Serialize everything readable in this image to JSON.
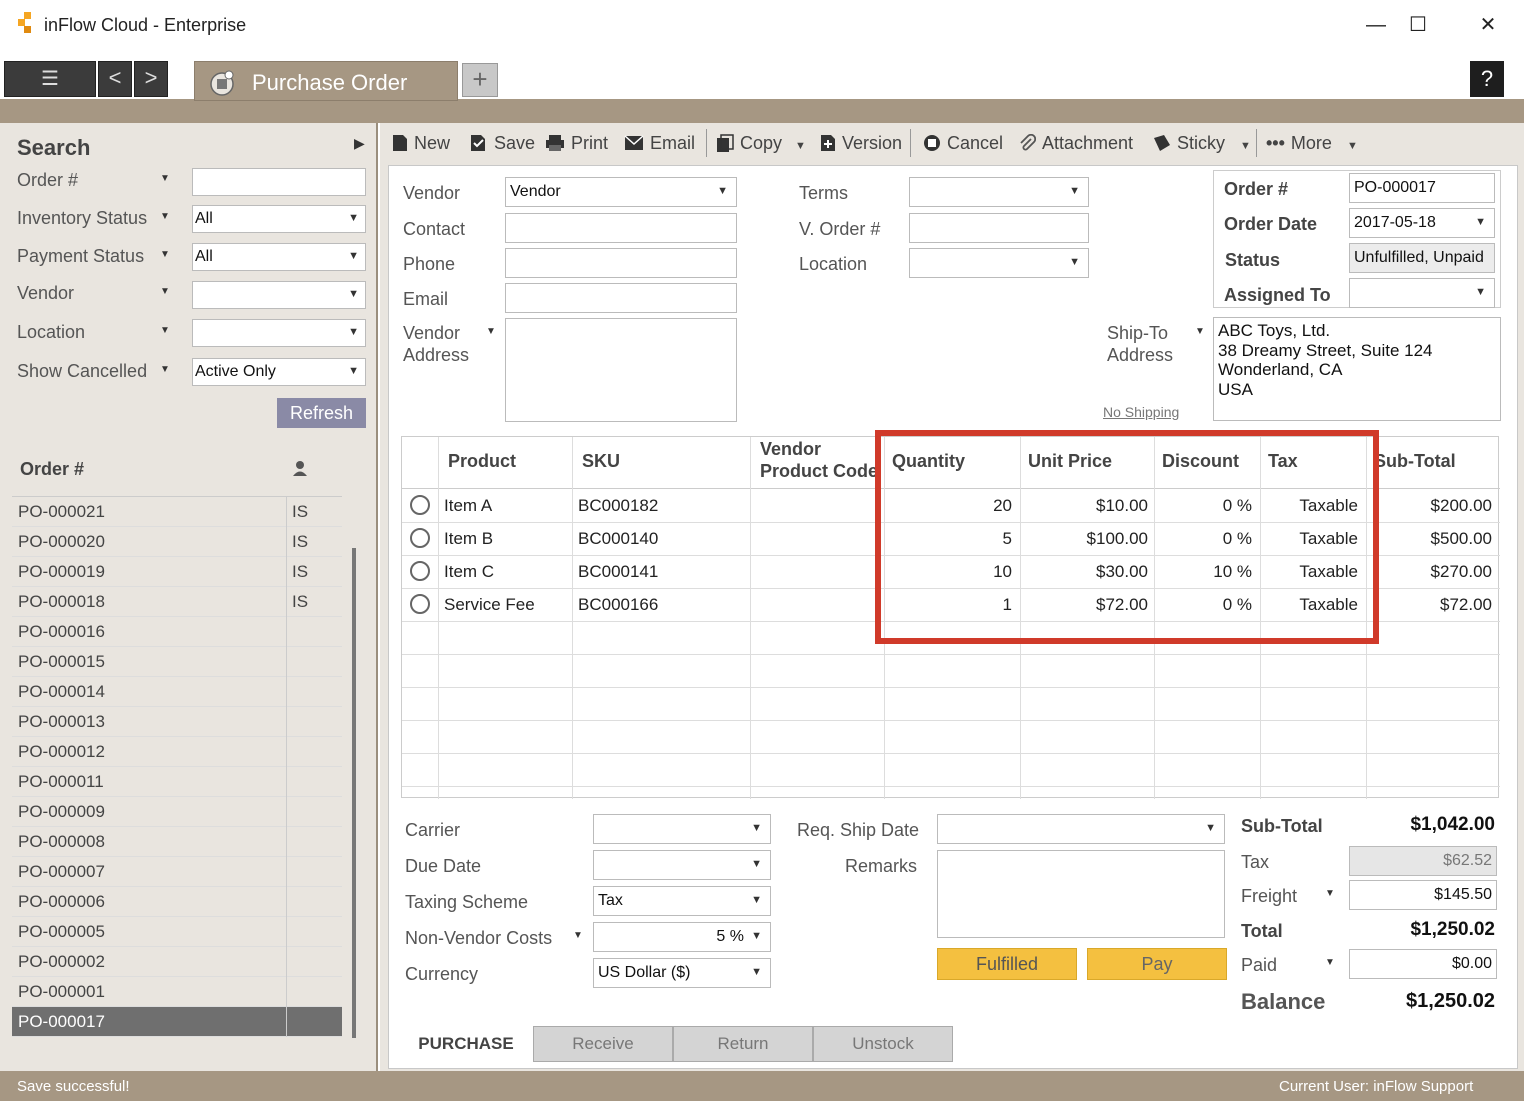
{
  "window": {
    "title": "inFlow Cloud - Enterprise",
    "minimize": "—",
    "maximize": "☐",
    "close": "✕"
  },
  "nav": {
    "menu": "☰",
    "back": "<",
    "forward": ">",
    "plus": "+",
    "help": "?"
  },
  "tab": {
    "label": "Purchase Order"
  },
  "sidebar": {
    "header": "Search",
    "filters": [
      {
        "label": "Order #",
        "value": ""
      },
      {
        "label": "Inventory Status",
        "value": "All"
      },
      {
        "label": "Payment Status",
        "value": "All"
      },
      {
        "label": "Vendor",
        "value": ""
      },
      {
        "label": "Location",
        "value": ""
      },
      {
        "label": "Show Cancelled",
        "value": "Active Only"
      }
    ],
    "refresh": "Refresh",
    "list_header": "Order #",
    "orders": [
      {
        "num": "PO-000021",
        "status": "IS"
      },
      {
        "num": "PO-000020",
        "status": "IS"
      },
      {
        "num": "PO-000019",
        "status": "IS"
      },
      {
        "num": "PO-000018",
        "status": "IS"
      },
      {
        "num": "PO-000016",
        "status": ""
      },
      {
        "num": "PO-000015",
        "status": ""
      },
      {
        "num": "PO-000014",
        "status": ""
      },
      {
        "num": "PO-000013",
        "status": ""
      },
      {
        "num": "PO-000012",
        "status": ""
      },
      {
        "num": "PO-000011",
        "status": ""
      },
      {
        "num": "PO-000009",
        "status": ""
      },
      {
        "num": "PO-000008",
        "status": ""
      },
      {
        "num": "PO-000007",
        "status": ""
      },
      {
        "num": "PO-000006",
        "status": ""
      },
      {
        "num": "PO-000005",
        "status": ""
      },
      {
        "num": "PO-000002",
        "status": ""
      },
      {
        "num": "PO-000001",
        "status": ""
      },
      {
        "num": "PO-000017",
        "status": ""
      }
    ]
  },
  "toolbar": {
    "new": "New",
    "save": "Save",
    "print": "Print",
    "email": "Email",
    "copy": "Copy",
    "version": "Version",
    "cancel": "Cancel",
    "attachment": "Attachment",
    "sticky": "Sticky",
    "more": "More"
  },
  "form": {
    "vendor_label": "Vendor",
    "vendor_value": "Vendor",
    "contact_label": "Contact",
    "phone_label": "Phone",
    "email_label": "Email",
    "vendor_address_label1": "Vendor",
    "vendor_address_label2": "Address",
    "terms_label": "Terms",
    "vorder_label": "V. Order #",
    "location_label": "Location",
    "order_num_label": "Order #",
    "order_num_value": "PO-000017",
    "order_date_label": "Order Date",
    "order_date_value": "2017-05-18",
    "status_label": "Status",
    "status_value": "Unfulfilled, Unpaid",
    "assigned_label": "Assigned To",
    "shipto_label1": "Ship-To",
    "shipto_label2": "Address",
    "shipto_lines": [
      "ABC Toys, Ltd.",
      "38 Dreamy Street, Suite 124",
      "Wonderland, CA",
      "USA"
    ],
    "no_shipping": "No Shipping"
  },
  "grid": {
    "headers": {
      "product": "Product",
      "sku": "SKU",
      "vendor_code1": "Vendor",
      "vendor_code2": "Product Code",
      "quantity": "Quantity",
      "unit_price": "Unit Price",
      "discount": "Discount",
      "tax": "Tax",
      "subtotal": "Sub-Total"
    },
    "rows": [
      {
        "product": "Item A",
        "sku": "BC000182",
        "qty": "20",
        "price": "$10.00",
        "discount": "0 %",
        "tax": "Taxable",
        "subtotal": "$200.00"
      },
      {
        "product": "Item B",
        "sku": "BC000140",
        "qty": "5",
        "price": "$100.00",
        "discount": "0 %",
        "tax": "Taxable",
        "subtotal": "$500.00"
      },
      {
        "product": "Item C",
        "sku": "BC000141",
        "qty": "10",
        "price": "$30.00",
        "discount": "10 %",
        "tax": "Taxable",
        "subtotal": "$270.00"
      },
      {
        "product": "Service Fee",
        "sku": "BC000166",
        "qty": "1",
        "price": "$72.00",
        "discount": "0 %",
        "tax": "Taxable",
        "subtotal": "$72.00"
      }
    ]
  },
  "bottom": {
    "carrier_label": "Carrier",
    "due_label": "Due Date",
    "taxing_label": "Taxing Scheme",
    "taxing_value": "Tax",
    "nonvendor_label": "Non-Vendor Costs",
    "nonvendor_value": "5 %",
    "currency_label": "Currency",
    "currency_value": "US Dollar ($)",
    "reqship_label": "Req. Ship Date",
    "remarks_label": "Remarks",
    "fulfilled": "Fulfilled",
    "pay": "Pay",
    "subtotal_label": "Sub-Total",
    "subtotal_value": "$1,042.00",
    "tax_label": "Tax",
    "tax_value": "$62.52",
    "freight_label": "Freight",
    "freight_value": "$145.50",
    "total_label": "Total",
    "total_value": "$1,250.02",
    "paid_label": "Paid",
    "paid_value": "$0.00",
    "balance_label": "Balance",
    "balance_value": "$1,250.02"
  },
  "bottom_tabs": [
    "PURCHASE",
    "Receive",
    "Return",
    "Unstock"
  ],
  "status": {
    "message": "Save successful!",
    "user": "Current User:  inFlow Support"
  },
  "colors": {
    "accent": "#a69783",
    "highlight": "#d03a2a",
    "button_yellow": "#f4c040"
  }
}
